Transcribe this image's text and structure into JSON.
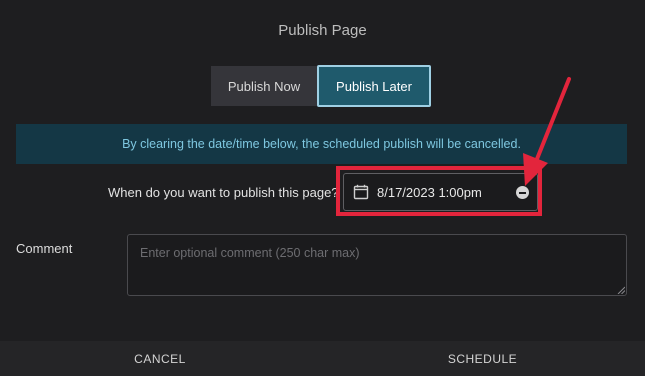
{
  "dialog": {
    "title": "Publish Page",
    "toggle": {
      "now_label": "Publish Now",
      "later_label": "Publish Later",
      "selected": "Publish Later"
    },
    "notice": "By clearing the date/time below, the scheduled publish will be cancelled.",
    "schedule": {
      "question": "When do you want to publish this page?",
      "date_value": "8/17/2023 1:00pm",
      "calendar_icon": "calendar-icon",
      "clear_icon": "minus-circle-icon"
    },
    "comment": {
      "label": "Comment",
      "placeholder": "Enter optional comment (250 char max)"
    },
    "footer": {
      "cancel_label": "CANCEL",
      "schedule_label": "SCHEDULE"
    }
  },
  "annotation": {
    "color": "#e3253c"
  },
  "colors": {
    "background": "#1e1e20",
    "accent": "#1f5a6c",
    "notice_bg": "#143745",
    "notice_text": "#7ec7e0"
  }
}
